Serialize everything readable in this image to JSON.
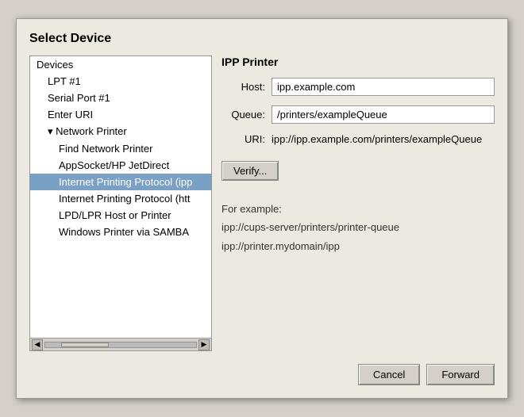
{
  "dialog": {
    "title": "Select Device"
  },
  "left_panel": {
    "category_label": "Devices",
    "items": [
      {
        "id": "lpt1",
        "label": "LPT #1",
        "indent": "sub-item",
        "selected": false
      },
      {
        "id": "serial1",
        "label": "Serial Port #1",
        "indent": "sub-item",
        "selected": false
      },
      {
        "id": "enter-uri",
        "label": "Enter URI",
        "indent": "sub-item",
        "selected": false
      },
      {
        "id": "network-printer",
        "label": "▾ Network Printer",
        "indent": "category",
        "selected": false
      },
      {
        "id": "find-network",
        "label": "Find Network Printer",
        "indent": "sub-item-deep",
        "selected": false
      },
      {
        "id": "appsocket",
        "label": "AppSocket/HP JetDirect",
        "indent": "sub-item-deep",
        "selected": false
      },
      {
        "id": "ipp",
        "label": "Internet Printing Protocol (ipp",
        "indent": "sub-item-deep",
        "selected": true
      },
      {
        "id": "http",
        "label": "Internet Printing Protocol (htt",
        "indent": "sub-item-deep",
        "selected": false
      },
      {
        "id": "lpd",
        "label": "LPD/LPR Host or Printer",
        "indent": "sub-item-deep",
        "selected": false
      },
      {
        "id": "samba",
        "label": "Windows Printer via SAMBA",
        "indent": "sub-item-deep",
        "selected": false
      }
    ]
  },
  "right_panel": {
    "title": "IPP Printer",
    "fields": {
      "host_label": "Host:",
      "host_value": "ipp.example.com",
      "host_placeholder": "ipp.example.com",
      "queue_label": "Queue:",
      "queue_value": "/printers/exampleQueue",
      "queue_placeholder": "/printers/exampleQueue",
      "uri_label": "URI:",
      "uri_value": "ipp://ipp.example.com/printers/exampleQueue"
    },
    "verify_button": "Verify...",
    "example": {
      "label": "For example:",
      "lines": [
        "ipp://cups-server/printers/printer-queue",
        "ipp://printer.mydomain/ipp"
      ]
    }
  },
  "footer": {
    "cancel_label": "Cancel",
    "forward_label": "Forward"
  }
}
